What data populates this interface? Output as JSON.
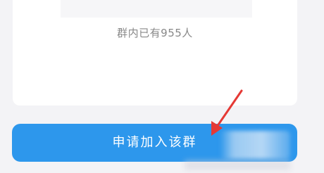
{
  "group": {
    "member_count_text": "群内已有955人"
  },
  "actions": {
    "join_label": "申请加入该群"
  },
  "annotation": {
    "arrow_color": "#e53935"
  },
  "theme": {
    "accent": "#2d97ec",
    "background": "#f3f3f6",
    "card": "#ffffff"
  }
}
